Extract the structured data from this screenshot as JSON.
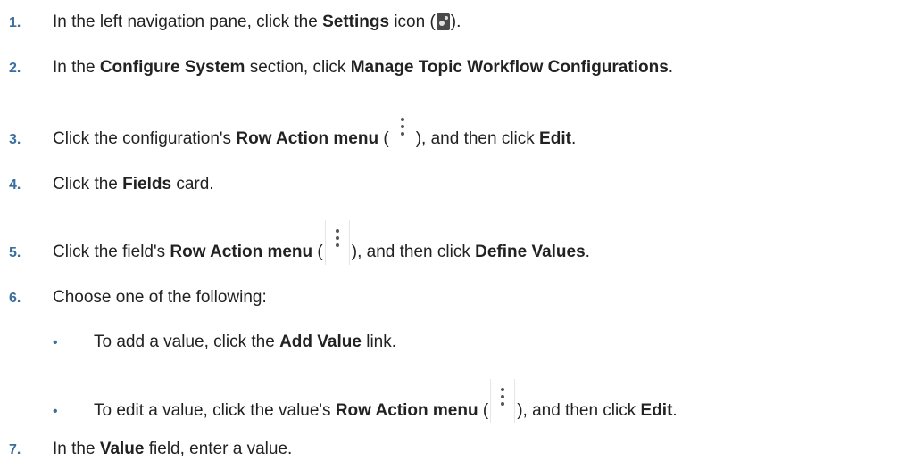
{
  "steps": [
    {
      "number": "1.",
      "parts": [
        "In the left navigation pane, click the ",
        "Settings",
        " icon (",
        "gear-icon",
        ")."
      ]
    },
    {
      "number": "2.",
      "parts": [
        "In the ",
        "Configure System",
        " section, click ",
        "Manage Topic Workflow Configurations",
        "."
      ]
    },
    {
      "number": "3.",
      "parts": [
        "Click the configuration's ",
        "Row Action menu",
        " (",
        "kebab-icon",
        "), and then click ",
        "Edit",
        "."
      ]
    },
    {
      "number": "4.",
      "parts": [
        "Click the ",
        "Fields",
        " card."
      ]
    },
    {
      "number": "5.",
      "parts": [
        "Click the field's ",
        "Row Action menu",
        " (",
        "kebab-icon",
        "), and then click ",
        "Define Values",
        "."
      ]
    },
    {
      "number": "6.",
      "parts": [
        "Choose one of the following:"
      ]
    },
    {
      "number": "7.",
      "parts": [
        "In the ",
        "Value",
        " field, enter a value."
      ]
    }
  ],
  "substeps": [
    {
      "bullet": "•",
      "parts": [
        "To add a value, click the ",
        "Add Value",
        " link."
      ]
    },
    {
      "bullet": "•",
      "parts": [
        "To edit a value, click the value's ",
        "Row Action menu",
        " (",
        "kebab-icon",
        "), and then click ",
        "Edit",
        "."
      ]
    }
  ],
  "colors": {
    "step_number": "#3a6e9e",
    "text": "#222222",
    "icon": "#4a4a4a"
  }
}
